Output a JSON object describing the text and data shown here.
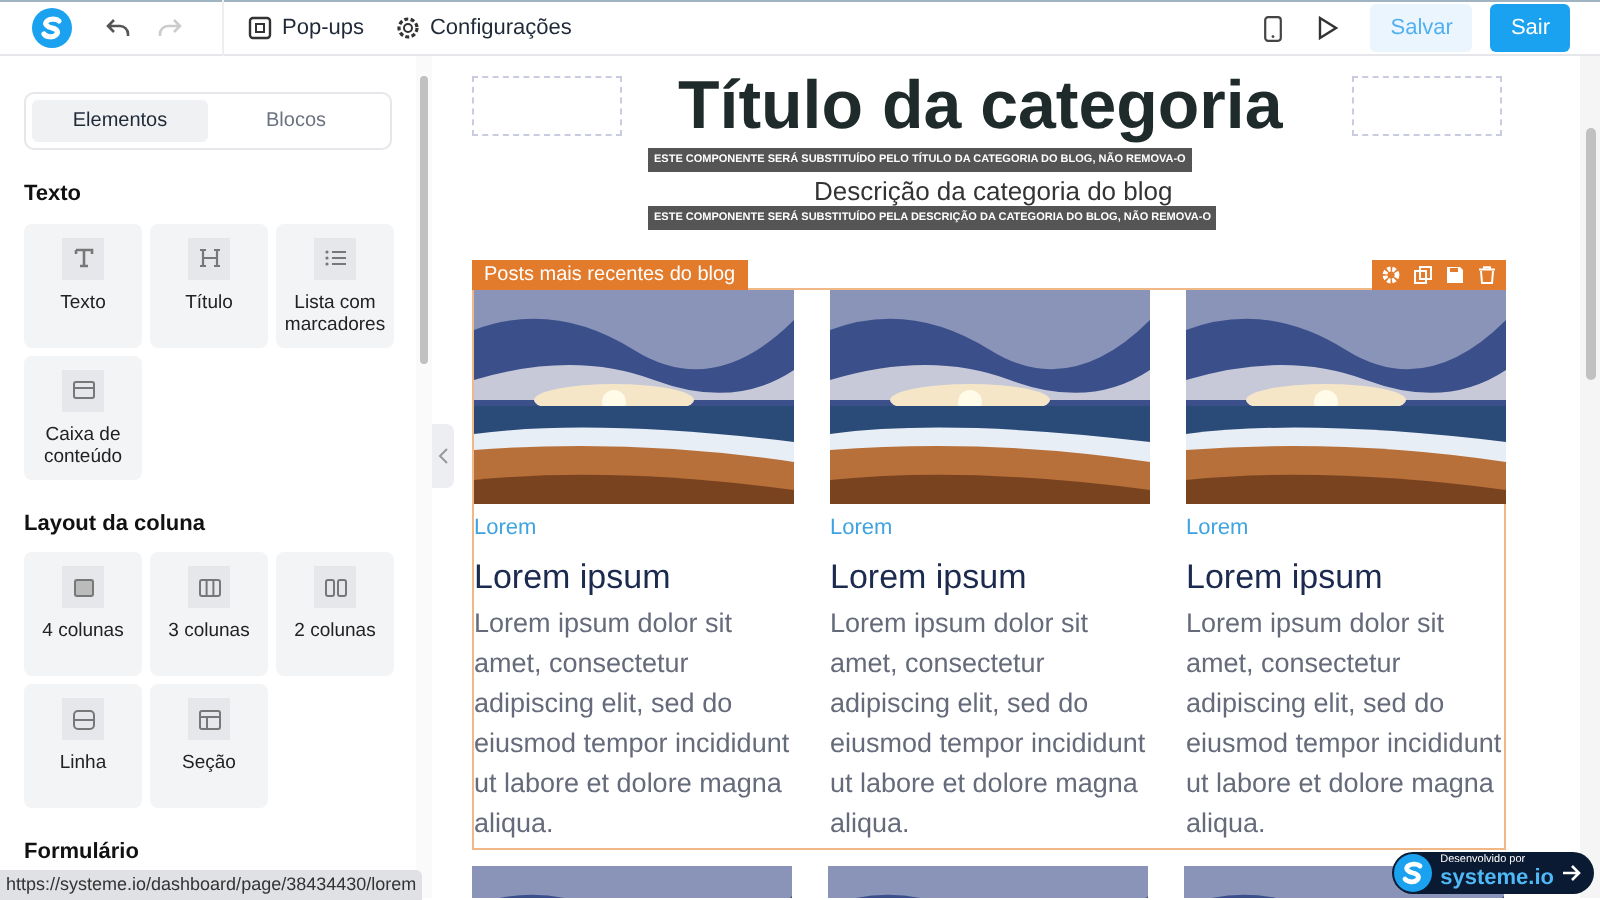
{
  "topbar": {
    "pop_ups": "Pop-ups",
    "settings": "Configurações",
    "save": "Salvar",
    "exit": "Sair"
  },
  "sidebar": {
    "tabs": [
      {
        "label": "Elementos",
        "selected": true
      },
      {
        "label": "Blocos",
        "selected": false
      }
    ],
    "sections": [
      {
        "title": "Texto",
        "items": [
          {
            "label": "Texto",
            "kind": "text"
          },
          {
            "label": "Título",
            "kind": "heading"
          },
          {
            "label": "Lista com marcadores",
            "kind": "list"
          },
          {
            "label": "Caixa de conteúdo",
            "kind": "box"
          }
        ]
      },
      {
        "title": "Layout da coluna",
        "items": [
          {
            "label": "4 colunas",
            "kind": "col4"
          },
          {
            "label": "3 colunas",
            "kind": "col3"
          },
          {
            "label": "2 colunas",
            "kind": "col2"
          },
          {
            "label": "Linha",
            "kind": "row"
          },
          {
            "label": "Seção",
            "kind": "section"
          }
        ]
      },
      {
        "title": "Formulário"
      }
    ]
  },
  "canvas": {
    "title": "Título da categoria",
    "title_note": "ESTE COMPONENTE SERÁ SUBSTITUÍDO PELO TÍTULO DA CATEGORIA DO BLOG, NÃO REMOVA-O",
    "description": "Descrição da categoria do blog",
    "description_note": "ESTE COMPONENTE SERÁ SUBSTITUÍDO PELA DESCRIÇÃO DA CATEGORIA DO BLOG, NÃO REMOVA-O",
    "blog_block": {
      "label": "Posts mais recentes do blog",
      "posts": [
        {
          "category": "Lorem",
          "title": "Lorem ipsum",
          "excerpt": "Lorem ipsum dolor sit amet, consectetur adipiscing elit, sed do eiusmod tempor incididunt ut labore et dolore magna aliqua."
        },
        {
          "category": "Lorem",
          "title": "Lorem ipsum",
          "excerpt": "Lorem ipsum dolor sit amet, consectetur adipiscing elit, sed do eiusmod tempor incididunt ut labore et dolore magna aliqua."
        },
        {
          "category": "Lorem",
          "title": "Lorem ipsum",
          "excerpt": "Lorem ipsum dolor sit amet, consectetur adipiscing elit, sed do eiusmod tempor incididunt ut labore et dolore magna aliqua."
        }
      ]
    }
  },
  "badge": {
    "caption": "Desenvolvido por",
    "brand": "systeme.io"
  },
  "status_url": "https://systeme.io/dashboard/page/38434430/lorem"
}
